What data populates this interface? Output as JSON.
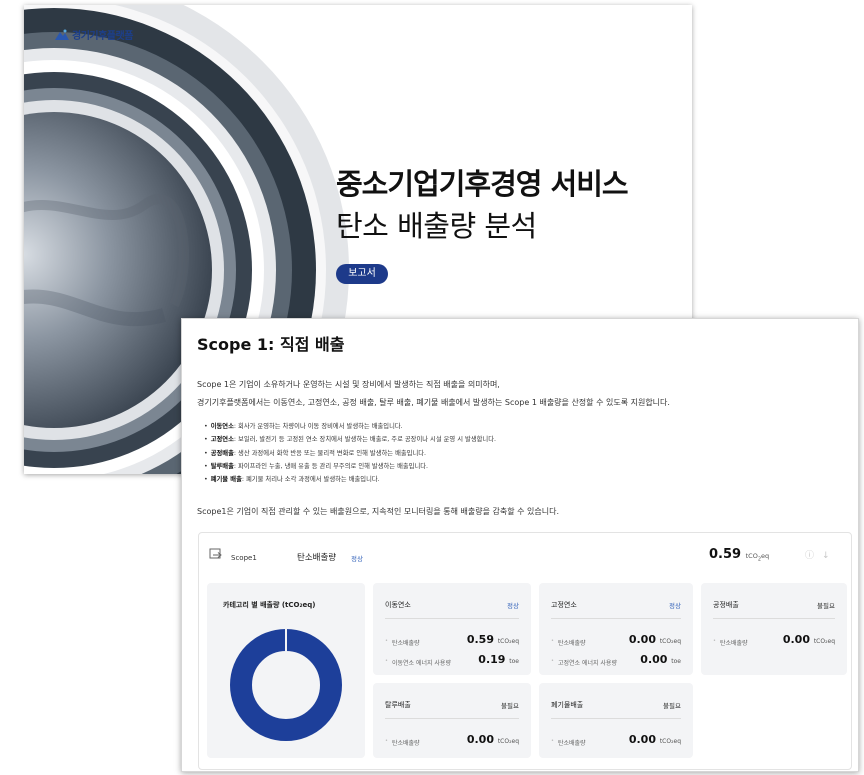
{
  "cover": {
    "logo_text": "경기기후플랫폼",
    "title_line1": "중소기업기후경영 서비스",
    "title_line2": "탄소 배출량 분석",
    "tag": "보고서"
  },
  "report": {
    "title": "Scope 1: 직접 배출",
    "intro_line1": "Scope 1은 기업이 소유하거나 운영하는 시설 및 장비에서 발생하는 직접 배출을 의미하며,",
    "intro_line2": "경기기후플랫폼에서는 이동연소, 고정연소, 공정 배출, 탈루 배출, 폐기물 배출에서 발생하는 Scope 1 배출량을 산정할 수 있도록 지원합니다.",
    "definitions": [
      {
        "term": "이동연소",
        "desc": ": 회사가 운영하는 차량이나 이동 장비에서 발생하는 배출입니다."
      },
      {
        "term": "고정연소",
        "desc": ": 보일러, 발전기 등 고정된 연소 장치에서 발생하는 배출로, 주로 공장이나 시설 운영 시 발생합니다."
      },
      {
        "term": "공정배출",
        "desc": ": 생산 과정에서 화학 반응 또는 물리적 변화로 인해 발생하는 배출입니다."
      },
      {
        "term": "탈루배출",
        "desc": ": 파이프라인 누출, 냉매 유출 등 관리 부주의로 인해 발생하는 배출입니다."
      },
      {
        "term": "폐기물 배출",
        "desc": ": 폐기물 처리나 소각 과정에서 발생하는 배출입니다."
      }
    ],
    "outro": "Scope1은 기업이 직접 관리할 수 있는 배출원으로, 지속적인 모니터링을 통해 배출량을 감축할 수 있습니다."
  },
  "panel": {
    "scope_label": "Scope1",
    "emission_label": "탄소배출량",
    "status": "정상",
    "total_value": "0.59",
    "unit_main": "tCO",
    "unit_sub": "2",
    "unit_tail": "eq",
    "category_title": "카테고리 별 배출량 (tCO₂eq)",
    "donut": {
      "share": 1.0,
      "color": "#1d3f9a"
    },
    "cards": [
      {
        "title": "이동연소",
        "status": "정상",
        "metrics": [
          {
            "label": "탄소배출량",
            "value": "0.59",
            "unit": "tCO₂eq"
          },
          {
            "label": "이동연소 에너지 사용량",
            "value": "0.19",
            "unit": "toe"
          }
        ]
      },
      {
        "title": "고정연소",
        "status": "정상",
        "metrics": [
          {
            "label": "탄소배출량",
            "value": "0.00",
            "unit": "tCO₂eq"
          },
          {
            "label": "고정연소 에너지 사용량",
            "value": "0.00",
            "unit": "toe"
          }
        ]
      },
      {
        "title": "공정배출",
        "status": "불필요",
        "metrics": [
          {
            "label": "탄소배출량",
            "value": "0.00",
            "unit": "tCO₂eq"
          }
        ]
      },
      {
        "title": "탈루배출",
        "status": "불필요",
        "metrics": [
          {
            "label": "탄소배출량",
            "value": "0.00",
            "unit": "tCO₂eq"
          }
        ]
      },
      {
        "title": "폐기물배출",
        "status": "불필요",
        "metrics": [
          {
            "label": "탄소배출량",
            "value": "0.00",
            "unit": "tCO₂eq"
          }
        ]
      }
    ]
  }
}
